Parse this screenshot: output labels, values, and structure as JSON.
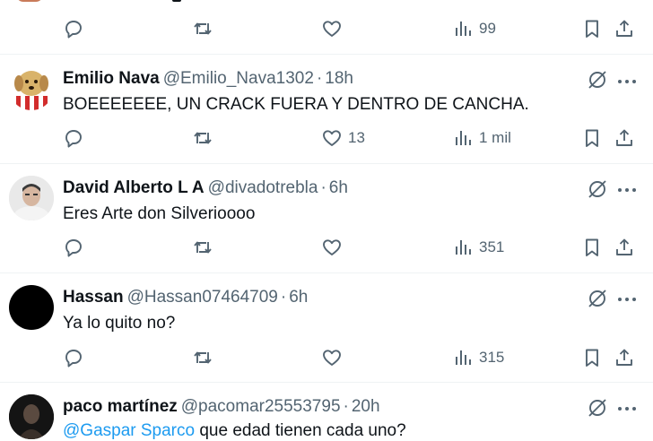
{
  "actions_icons": {
    "reply": "reply-icon",
    "repost": "repost-icon",
    "like": "heart-icon",
    "views": "views-icon",
    "bookmark": "bookmark-icon",
    "share": "share-icon",
    "grok": "grok-icon",
    "more": "more-icon"
  },
  "top_post": {
    "views": "99"
  },
  "posts": [
    {
      "name": "Emilio Nava",
      "handle": "@Emilio_Nava1302",
      "sep": "·",
      "time": "18h",
      "text": "BOEEEEEEE, UN CRACK FUERA Y DENTRO DE CANCHA.",
      "likes": "13",
      "views": "1 mil"
    },
    {
      "name": "David Alberto L A",
      "handle": "@divadotrebla",
      "sep": "·",
      "time": "6h",
      "text": "Eres Arte don Silverioooo",
      "likes": "",
      "views": "351"
    },
    {
      "name": "Hassan",
      "handle": "@Hassan07464709",
      "sep": "·",
      "time": "6h",
      "text": "Ya lo quito no?",
      "likes": "",
      "views": "315"
    },
    {
      "name": "paco martínez",
      "handle": "@pacomar25553795",
      "sep": "·",
      "time": "20h",
      "mention": "@Gaspar Sparco",
      "text": " que edad tienen cada uno?"
    }
  ],
  "colors": {
    "accent": "#1d9bf0",
    "muted": "#536471",
    "text": "#0f1419",
    "divider": "#eff3f4"
  }
}
